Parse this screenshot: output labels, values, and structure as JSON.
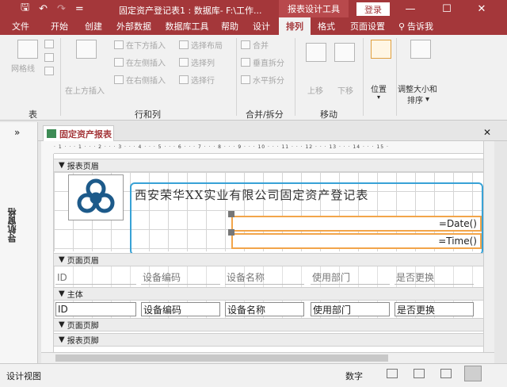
{
  "window": {
    "title": "固定资产登记表1 : 数据库- F:\\工作...",
    "context_tool": "报表设计工具",
    "login": "登录",
    "minimize": "—",
    "maximize": "☐",
    "close": "✕"
  },
  "qat": {
    "save": "🖫",
    "undo": "↶",
    "redo": "↷",
    "more": "="
  },
  "tabs": [
    "文件",
    "开始",
    "创建",
    "外部数据",
    "数据库工具",
    "帮助",
    "设计",
    "排列",
    "格式",
    "页面设置"
  ],
  "tellme": "告诉我",
  "ribbon": {
    "table_group": {
      "label": "表",
      "gridlines": "网格线"
    },
    "rows_cols_group": {
      "label": "行和列",
      "insert_above": "在上方插入",
      "insert_below": "在下方插入",
      "insert_left": "在左侧插入",
      "insert_right": "在右侧插入",
      "select_layout": "选择布局",
      "select_column": "选择列",
      "select_row": "选择行"
    },
    "merge_group": {
      "label": "合并/拆分",
      "merge": "合并",
      "split_vert": "垂直拆分",
      "split_horiz": "水平拆分"
    },
    "move_group": {
      "label": "移动",
      "up": "上移",
      "down": "下移"
    },
    "position": "位置",
    "size": "调整大小和",
    "sort": "排序"
  },
  "nav": {
    "expand": "»",
    "title": "导航窗格"
  },
  "doc_tab": {
    "label": "固定资产报表",
    "close": "✕"
  },
  "ruler": "· 1 · · · 1 · · · 2 · · · 3 · · · 4 · · · 5 · · · 6 · · · 7 · · · 8 · · · 9 · · · 10 · · · 11 · · · 12 · · · 13 · · · 14 · · · 15 ·",
  "sections": {
    "report_header": "报表页眉",
    "page_header": "页面页眉",
    "detail": "主体",
    "page_footer": "页面页脚",
    "report_footer": "报表页脚"
  },
  "report": {
    "title": "西安荣华XX实业有限公司固定资产登记表",
    "date_expr": "=Date()",
    "time_expr": "=Time()"
  },
  "fields": [
    "ID",
    "设备编码",
    "设备名称",
    "使用部门",
    "是否更换"
  ],
  "status": {
    "mode": "设计视图",
    "numlock": "数字"
  },
  "colors": {
    "accent": "#a4373a",
    "selection": "#f2a54a",
    "highlight": "#38a2d6"
  }
}
